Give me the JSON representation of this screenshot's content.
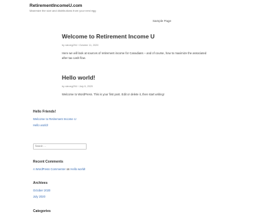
{
  "site": {
    "title": "RetirementIncomeU.com",
    "tagline": "Maximize the size and distributions from your nest egg"
  },
  "nav": {
    "sample_page": "Sample Page"
  },
  "posts": [
    {
      "title": "Welcome to Retirement Income U",
      "meta_by": "by",
      "author": "steveg294",
      "sep": "/",
      "date": "October 11, 2020",
      "excerpt": "Here we will look at sources of retirement income for Canadians – and of course, how to maximize the associated after tax cash flow."
    },
    {
      "title": "Hello world!",
      "meta_by": "by",
      "author": "steveg294",
      "sep": "/",
      "date": "July 6, 2020",
      "excerpt": "Welcome to WordPress. This is your first post. Edit or delete it, then start writing!"
    }
  ],
  "sidebar": {
    "hello_friends": {
      "title": "Hello Friends!",
      "links": [
        "Welcome to Retirement Income U",
        "Hello world!"
      ]
    },
    "search": {
      "placeholder": "Search …"
    },
    "recent_comments": {
      "title": "Recent Comments",
      "commenter": "A WordPress Commenter",
      "on": "on",
      "post": "Hello world!"
    },
    "archives": {
      "title": "Archives",
      "links": [
        "October 2020",
        "July 2020"
      ]
    },
    "categories": {
      "title": "Categories"
    }
  }
}
